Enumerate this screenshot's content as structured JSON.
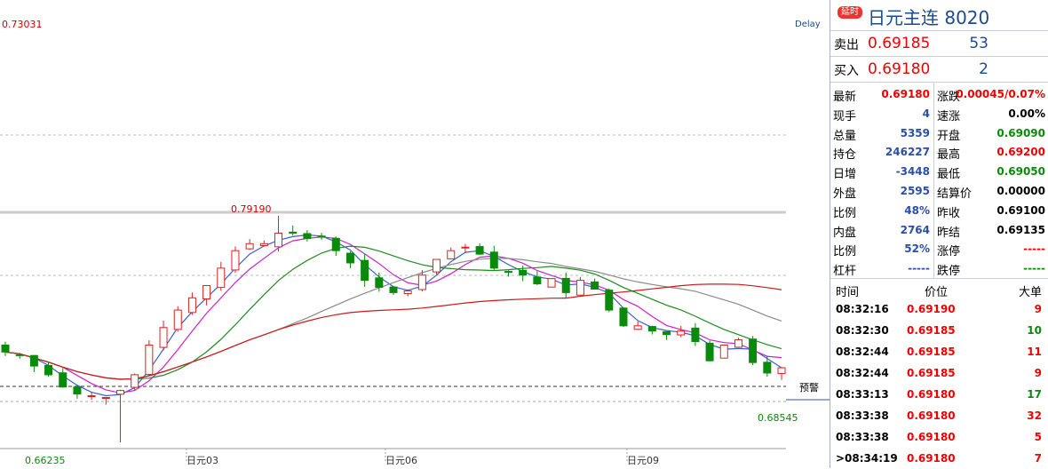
{
  "chart": {
    "top_price_label": "0.73031",
    "delay": "Delay",
    "high_label": "0.79190",
    "low_left_label": "0.66235",
    "low_right_label": "0.68545",
    "alert_label": "预警",
    "x_labels": [
      "日元03",
      "日元06",
      "日元09"
    ],
    "colors": {
      "up": "#e02020",
      "down": "#0a8a0a",
      "ma_blue": "#3a5fcd",
      "ma_magenta": "#d020c8",
      "ma_green": "#1f8a1f",
      "ma_gray": "#8a8a8a",
      "ma_red": "#cc1a1a"
    }
  },
  "chart_data": {
    "type": "candlestick",
    "annotations": {
      "max": 0.7919,
      "min": 0.66235,
      "last_low": 0.68545,
      "top": 0.73031
    },
    "series": [
      {
        "values": [
          0.714,
          0.712,
          0.706,
          0.701,
          0.694,
          0.69,
          0.689,
          0.688,
          0.692,
          0.701,
          0.718,
          0.728,
          0.738,
          0.745,
          0.752,
          0.762,
          0.772,
          0.776,
          0.776,
          0.782,
          0.782,
          0.779,
          0.78,
          0.772,
          0.765,
          0.755,
          0.751,
          0.748,
          0.749,
          0.758,
          0.767,
          0.772,
          0.774,
          0.77,
          0.762,
          0.76,
          0.758,
          0.753,
          0.756,
          0.748,
          0.755,
          0.75,
          0.738,
          0.729,
          0.729,
          0.726,
          0.724,
          0.726,
          0.72,
          0.709,
          0.718,
          0.721,
          0.708,
          0.702,
          0.705
        ]
      }
    ]
  },
  "panel": {
    "tag": "延时",
    "title": "日元主连  8020",
    "sell": {
      "label": "卖出",
      "price": "0.69185",
      "vol": "53"
    },
    "buy": {
      "label": "买入",
      "price": "0.69180",
      "vol": "2"
    },
    "left": [
      {
        "k": "最新",
        "v": "0.69180",
        "c": "red"
      },
      {
        "k": "现手",
        "v": "4",
        "c": "blue"
      },
      {
        "k": "总量",
        "v": "5359",
        "c": "blue"
      },
      {
        "k": "持仓",
        "v": "246227",
        "c": "blue"
      },
      {
        "k": "日增",
        "v": "-3448",
        "c": "blue"
      },
      {
        "k": "外盘",
        "v": "2595",
        "c": "blue"
      },
      {
        "k": "比例",
        "v": "48%",
        "c": "blue"
      },
      {
        "k": "内盘",
        "v": "2764",
        "c": "blue"
      },
      {
        "k": "比例",
        "v": "52%",
        "c": "blue"
      },
      {
        "k": "杠杆",
        "v": "-----",
        "c": "blue"
      }
    ],
    "right": [
      {
        "k": "涨跌",
        "v": "0.00045/0.07%",
        "c": "red"
      },
      {
        "k": "速涨",
        "v": "0.00%",
        "c": "black"
      },
      {
        "k": "开盘",
        "v": "0.69090",
        "c": "green"
      },
      {
        "k": "最高",
        "v": "0.69200",
        "c": "red"
      },
      {
        "k": "最低",
        "v": "0.69050",
        "c": "green"
      },
      {
        "k": "结算价",
        "v": "0.00000",
        "c": "black"
      },
      {
        "k": "昨收",
        "v": "0.69100",
        "c": "black"
      },
      {
        "k": "昨结",
        "v": "0.69135",
        "c": "black"
      },
      {
        "k": "涨停",
        "v": "-----",
        "c": "red"
      },
      {
        "k": "跌停",
        "v": "-----",
        "c": "green"
      }
    ],
    "trades_header": {
      "time": "时间",
      "price": "价位",
      "big": "大单"
    },
    "trades": [
      {
        "time": "08:32:16",
        "price": "0.69190",
        "vol": "9",
        "c": "red"
      },
      {
        "time": "08:32:30",
        "price": "0.69185",
        "vol": "10",
        "c": "green"
      },
      {
        "time": "08:32:44",
        "price": "0.69185",
        "vol": "11",
        "c": "red"
      },
      {
        "time": "08:32:44",
        "price": "0.69185",
        "vol": "9",
        "c": "red"
      },
      {
        "time": "08:33:13",
        "price": "0.69180",
        "vol": "17",
        "c": "green"
      },
      {
        "time": "08:33:38",
        "price": "0.69180",
        "vol": "32",
        "c": "red"
      },
      {
        "time": "08:33:38",
        "price": "0.69180",
        "vol": "5",
        "c": "red"
      },
      {
        "time": ">08:34:19",
        "price": "0.69180",
        "vol": "7",
        "c": "red"
      }
    ]
  }
}
